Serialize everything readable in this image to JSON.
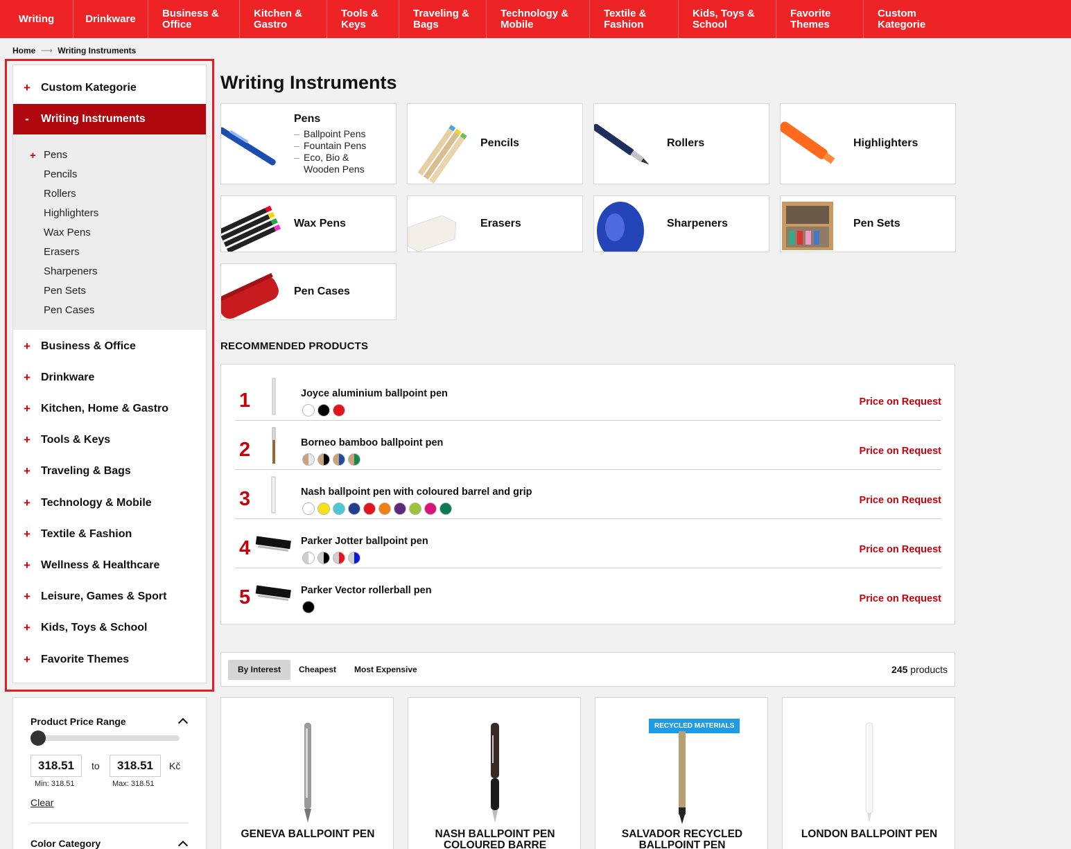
{
  "topnav": [
    {
      "label": "Writing"
    },
    {
      "label": "Drinkware"
    },
    {
      "label": "Business &\nOffice"
    },
    {
      "label": "Kitchen &\nGastro"
    },
    {
      "label": "Tools &\nKeys"
    },
    {
      "label": "Traveling &\nBags"
    },
    {
      "label": "Technology &\nMobile"
    },
    {
      "label": "Textile &\nFashion"
    },
    {
      "label": "Kids, Toys &\nSchool"
    },
    {
      "label": "Favorite\nThemes"
    },
    {
      "label": "Custom\nKategorie"
    }
  ],
  "breadcrumb": {
    "home": "Home",
    "separator": "⟶",
    "current": "Writing Instruments"
  },
  "sidebar": {
    "custom": {
      "icon": "+",
      "label": "Custom Kategorie"
    },
    "active": {
      "icon": "-",
      "label": "Writing Instruments"
    },
    "subitems": [
      "Pens",
      "Pencils",
      "Rollers",
      "Highlighters",
      "Wax Pens",
      "Erasers",
      "Sharpeners",
      "Pen Sets",
      "Pen Cases"
    ],
    "subplus": "+",
    "categories": [
      "Business & Office",
      "Drinkware",
      "Kitchen, Home & Gastro",
      "Tools & Keys",
      "Traveling & Bags",
      "Technology & Mobile",
      "Textile & Fashion",
      "Wellness & Healthcare",
      "Leisure, Games & Sport",
      "Kids, Toys & School",
      "Favorite Themes"
    ],
    "plus": "+"
  },
  "filters": {
    "price": {
      "title": "Product Price Range",
      "min_value": "318.51",
      "max_value": "318.51",
      "to": "to",
      "currency": "Kč",
      "min_label": "Min: 318.51",
      "max_label": "Max: 318.51",
      "clear": "Clear"
    },
    "color": {
      "title": "Color Category"
    }
  },
  "page_title": "Writing Instruments",
  "categories": [
    {
      "name": "Pens",
      "subs": [
        "Ballpoint Pens",
        "Fountain Pens",
        "Eco, Bio & Wooden Pens"
      ]
    },
    {
      "name": "Pencils"
    },
    {
      "name": "Rollers"
    },
    {
      "name": "Highlighters"
    },
    {
      "name": "Wax Pens"
    },
    {
      "name": "Erasers"
    },
    {
      "name": "Sharpeners"
    },
    {
      "name": "Pen Sets"
    },
    {
      "name": "Pen Cases"
    }
  ],
  "recommended": {
    "title": "RECOMMENDED PRODUCTS",
    "items": [
      {
        "rank": "1",
        "name": "Joyce aluminium ballpoint pen",
        "price": "Price on Request",
        "colors": [
          "#ffffff",
          "#000000",
          "#e0161c"
        ]
      },
      {
        "rank": "2",
        "name": "Borneo bamboo ballpoint pen",
        "price": "Price on Request",
        "colors": [
          "#c8a27a|#e8e8e8",
          "#c8a27a|#000000",
          "#c8a27a|#1f4aa0",
          "#c8a27a|#138a4a"
        ]
      },
      {
        "rank": "3",
        "name": "Nash ballpoint pen with coloured barrel and grip",
        "price": "Price on Request",
        "colors": [
          "#ffffff",
          "#f7e017",
          "#4cc9d0",
          "#1f3f8f",
          "#e0161c",
          "#f07f14",
          "#5b2a7a",
          "#9cc43b",
          "#d9137a",
          "#0a7a52"
        ]
      },
      {
        "rank": "4",
        "name": "Parker Jotter ballpoint pen",
        "price": "Price on Request",
        "colors": [
          "#cfcfcf|#ffffff",
          "#cfcfcf|#000000",
          "#cfcfcf|#e0161c",
          "#cfcfcf|#1018d8"
        ]
      },
      {
        "rank": "5",
        "name": "Parker Vector rollerball pen",
        "price": "Price on Request",
        "colors": [
          "#000000"
        ]
      }
    ]
  },
  "sort": {
    "options": [
      "By Interest",
      "Cheapest",
      "Most Expensive"
    ],
    "active": "By Interest",
    "count": "245",
    "count_label": "products"
  },
  "products": [
    {
      "name": "GENEVA BALLPOINT PEN"
    },
    {
      "name": "NASH BALLPOINT PEN COLOURED BARRE"
    },
    {
      "name": "SALVADOR RECYCLED BALLPOINT PEN",
      "badge": "RECYCLED MATERIALS"
    },
    {
      "name": "LONDON BALLPOINT PEN"
    }
  ],
  "colors": {
    "brand_red": "#ee2326",
    "dark_red": "#b0060d",
    "price_red": "#c8000a",
    "badge_blue": "#1e9be6"
  }
}
